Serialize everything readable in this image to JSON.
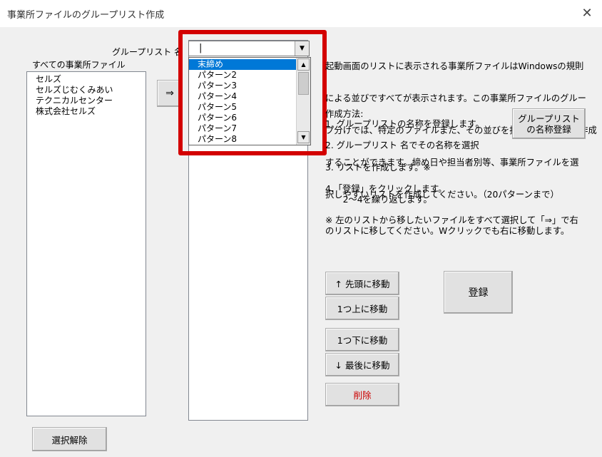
{
  "window": {
    "title": "事業所ファイルのグループリスト作成",
    "close_icon": "✕"
  },
  "labels": {
    "group_list_name": "グループリスト 名",
    "all_files": "すべての事業所ファイル"
  },
  "all_files_list": [
    "セルズ",
    "セルズじむくみあい",
    "テクニカルセンター",
    "株式会社セルズ"
  ],
  "move_button": "⇒",
  "combo": {
    "value": "|"
  },
  "dropdown": {
    "items": [
      "末締め",
      "パターン2",
      "パターン3",
      "パターン4",
      "パターン5",
      "パターン6",
      "パターン7",
      "パターン8"
    ],
    "selected_index": 0
  },
  "description": {
    "lines": [
      "起動画面のリストに表示される事業所ファイルはWindowsの規則",
      "による並びですべてが表示されます。この事業所ファイルのグルー",
      "プ分けでは、特定のファイルまた、その並びを指定してリストを作成",
      "することができます。締め日や担当者別等、事業所ファイルを選",
      "択しやすいリストを作成してください。（20パターンまで）"
    ]
  },
  "method": {
    "heading": "作成方法:",
    "step1": "1. グループリストの名称を登録します。",
    "step2": "2. グループリスト 名でその名称を選択",
    "step3": "3. リストを作成します。※",
    "step4a": "4.「登録」をクリックします。",
    "step4b": "　　2～4を繰り返します。",
    "note1": "※ 左のリストから移したいファイルをすべて選択して「⇒」で右",
    "note2": "のリストに移してください。Wクリックでも右に移動します。"
  },
  "buttons": {
    "register_name_line1": "グループリスト",
    "register_name_line2": "の名称登録",
    "move_top": "↑ 先頭に移動",
    "move_up": "1つ上に移動",
    "move_down": "1つ下に移動",
    "move_bottom": "↓ 最後に移動",
    "delete": "削除",
    "register": "登録",
    "deselect": "選択解除"
  },
  "colors": {
    "highlight": "#d30000",
    "selection": "#0078d7",
    "delete_text": "#cc0000"
  }
}
